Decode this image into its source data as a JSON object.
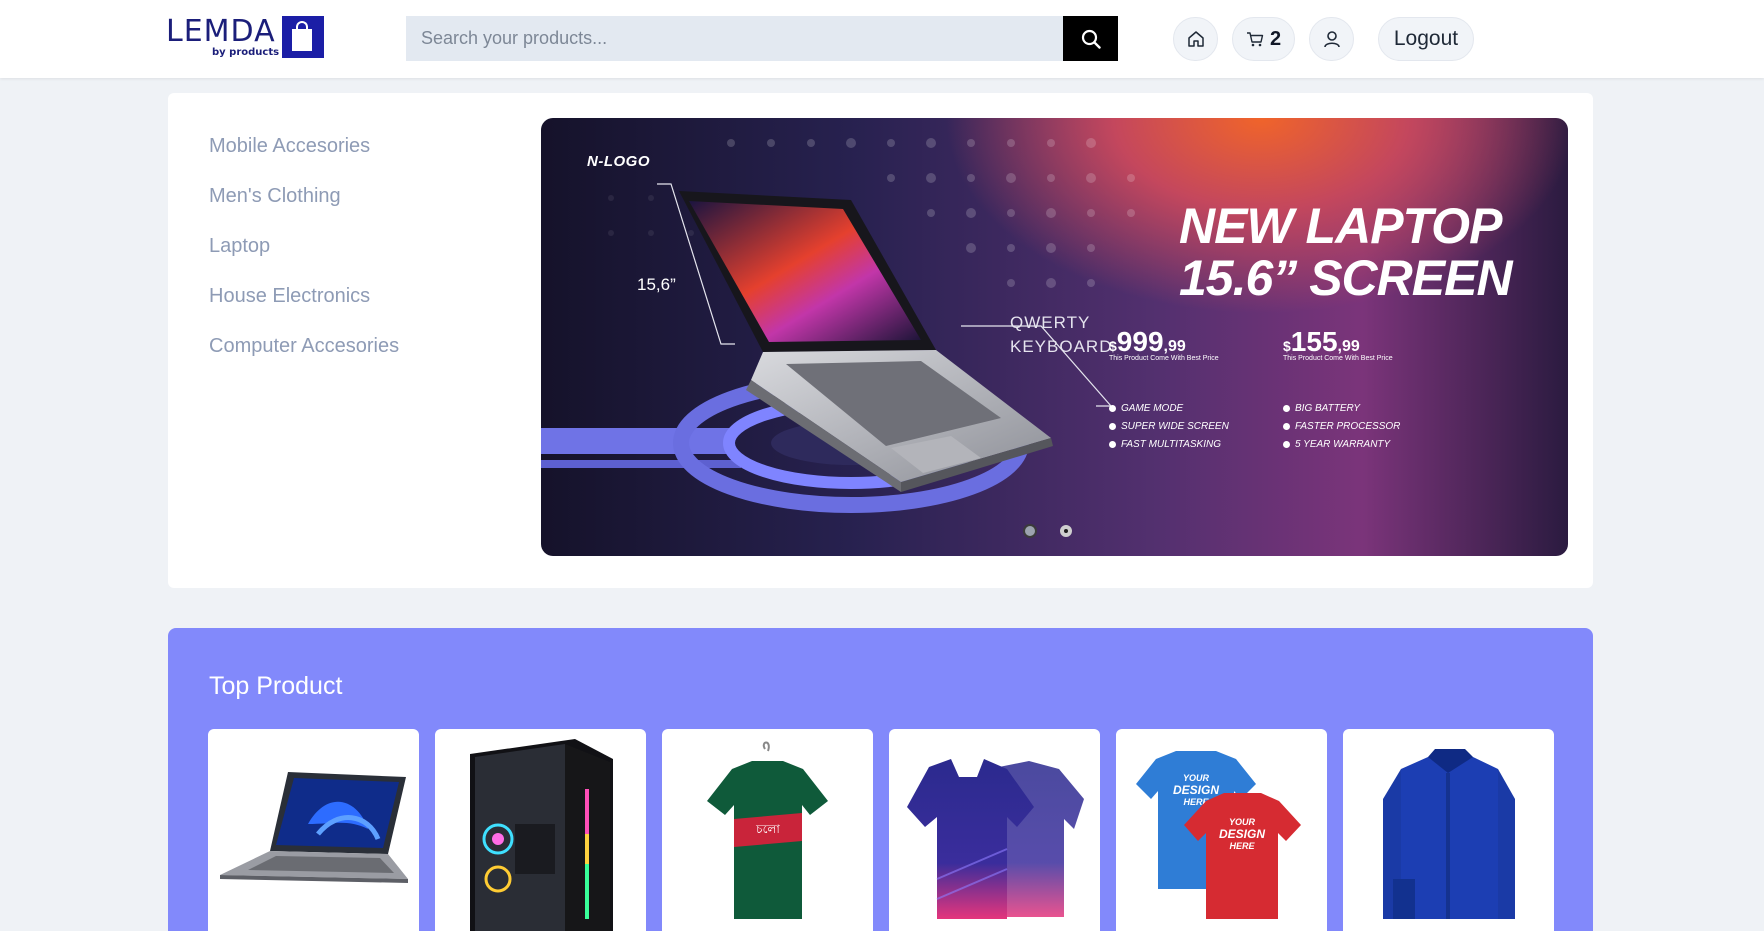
{
  "header": {
    "logo": {
      "name": "LEMDA",
      "tagline": "by products"
    },
    "search": {
      "placeholder": "Search your products..."
    },
    "cart_count": "2",
    "logout_label": "Logout"
  },
  "categories": [
    {
      "label": "Mobile Accesories"
    },
    {
      "label": "Men's Clothing"
    },
    {
      "label": "Laptop"
    },
    {
      "label": "House Electronics"
    },
    {
      "label": "Computer Accesories"
    }
  ],
  "banner": {
    "logo": "N-LOGO",
    "title": "NEW LAPTOP\n15.6” SCREEN",
    "screen_size": "15,6”",
    "keyboard": "QWERTY\nKEYBOARD",
    "price_1": {
      "currency": "$",
      "main": "999",
      "decimal": ",99",
      "note": "This Product Come With Best Price"
    },
    "price_2": {
      "currency": "$",
      "main": "155",
      "decimal": ",99",
      "note": "This Product Come With Best Price"
    },
    "features_left": [
      "GAME MODE",
      "SUPER WIDE SCREEN",
      "FAST MULTITASKING"
    ],
    "features_right": [
      "BIG BATTERY",
      "FASTER PROCESSOR",
      "5 YEAR WARRANTY"
    ],
    "slides": 2,
    "active_slide": 2
  },
  "top_product": {
    "title": "Top Product",
    "products": [
      {
        "name": "laptop"
      },
      {
        "name": "gaming-pc-case"
      },
      {
        "name": "green-tshirt"
      },
      {
        "name": "polo-jersey"
      },
      {
        "name": "design-tshirts"
      },
      {
        "name": "blue-shirt"
      }
    ]
  },
  "colors": {
    "brand": "#1b1ea6",
    "accent_section": "#8289fb",
    "category_text": "#8e9bb5",
    "page_bg": "#eff2f6"
  },
  "icons": [
    "search-icon",
    "home-icon",
    "cart-icon",
    "user-icon",
    "shopping-bag-icon"
  ]
}
